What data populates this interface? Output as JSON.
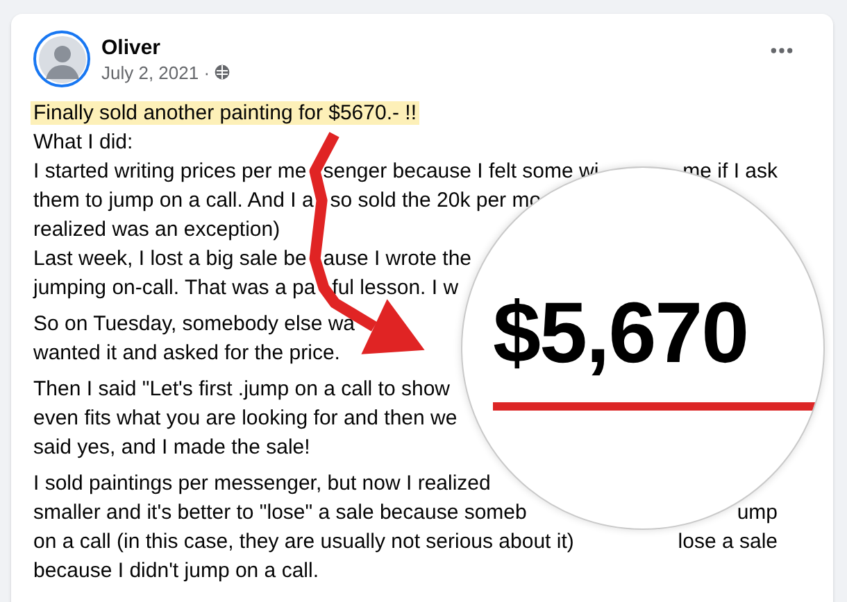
{
  "post": {
    "author": "Oliver",
    "date": "July 2, 2021 ·",
    "highlight": "Finally sold another painting for $5670.- !!",
    "paragraphs": [
      {
        "lines": [
          {
            "parts": [
              "What I did:"
            ]
          },
          {
            "parts": [
              "I started writing prices per me",
              "senger because I felt some wi"
            ],
            "right": "me if I ask"
          },
          {
            "parts": [
              "them to jump on a call. And I a",
              "so sold the 20k per mo"
            ]
          },
          {
            "parts": [
              "realized was an exception)"
            ]
          },
          {
            "parts": [
              "Last week, I lost a big sale be",
              "ause I wrote the"
            ]
          },
          {
            "parts": [
              "jumping on-call. That was a pa",
              "ful lesson. I w"
            ]
          }
        ]
      },
      {
        "lines": [
          {
            "parts": [
              "So on Tuesday, somebody else wa"
            ]
          },
          {
            "parts": [
              "wanted it and asked for the price."
            ]
          }
        ]
      },
      {
        "lines": [
          {
            "parts": [
              "Then I said \"Let's first .jump on a call to show"
            ]
          },
          {
            "parts": [
              "even fits what you are looking for and then we"
            ]
          },
          {
            "parts": [
              "said yes, and I made the sale!"
            ]
          }
        ]
      },
      {
        "lines": [
          {
            "parts": [
              "I sold paintings per messenger, but now I realized"
            ]
          },
          {
            "parts": [
              "smaller and it's better to \"lose\" a sale because someb"
            ],
            "right": "ump"
          },
          {
            "parts": [
              "on a call (in this case, they are usually not serious about it)"
            ],
            "right": "lose a sale"
          },
          {
            "parts": [
              "because I didn't jump on a call."
            ]
          }
        ]
      }
    ]
  },
  "callout": {
    "amount": "$5,670"
  }
}
